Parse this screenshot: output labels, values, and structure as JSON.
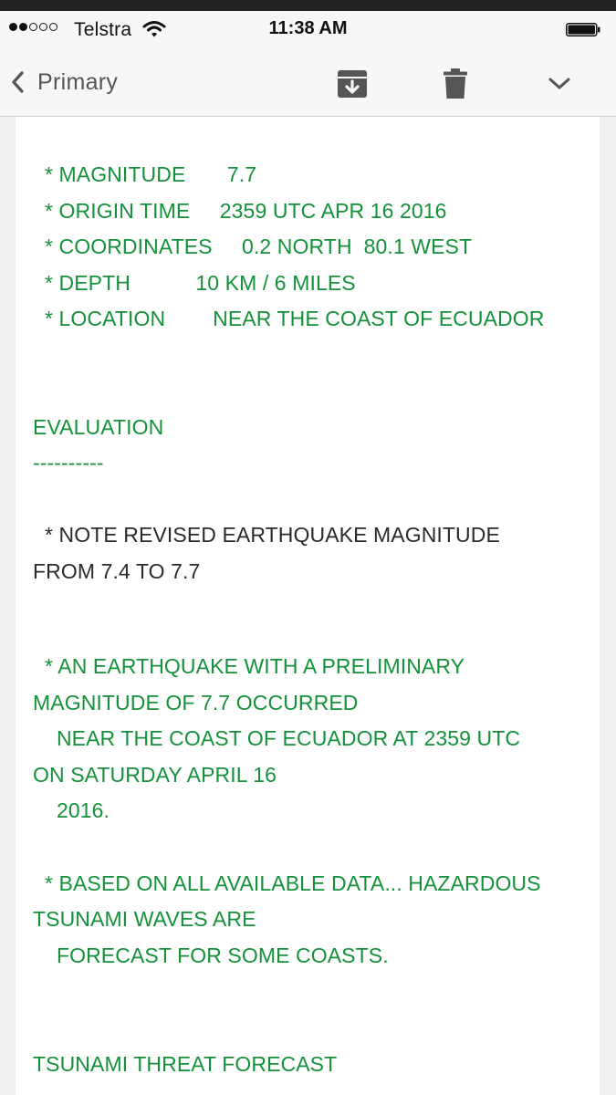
{
  "status_bar": {
    "carrier": "Telstra",
    "time": "11:38 AM",
    "signal_bars_filled": 2,
    "signal_bars_total": 5
  },
  "nav": {
    "back_label": "Primary",
    "icons": [
      "back-chevron-icon",
      "archive-icon",
      "trash-icon",
      "chevron-down-icon"
    ]
  },
  "colors": {
    "body_text_green": "#14913a",
    "body_text_dark": "#2a2a2a"
  },
  "email": {
    "lines": [
      "  * MAGNITUDE       7.7",
      "  * ORIGIN TIME     2359 UTC APR 16 2016",
      "  * COORDINATES     0.2 NORTH  80.1 WEST",
      "  * DEPTH           10 KM / 6 MILES",
      "  * LOCATION        NEAR THE COAST OF ECUADOR",
      "EVALUATION",
      "----------",
      "  * NOTE REVISED EARTHQUAKE MAGNITUDE",
      "FROM 7.4 TO 7.7",
      "  * AN EARTHQUAKE WITH A PRELIMINARY",
      "MAGNITUDE OF 7.7 OCCURRED",
      "    NEAR THE COAST OF ECUADOR AT 2359 UTC",
      "ON SATURDAY APRIL 16",
      "    2016.",
      "  * BASED ON ALL AVAILABLE DATA... HAZARDOUS",
      "TSUNAMI WAVES ARE",
      "    FORECAST FOR SOME COASTS.",
      "TSUNAMI THREAT FORECAST"
    ]
  }
}
